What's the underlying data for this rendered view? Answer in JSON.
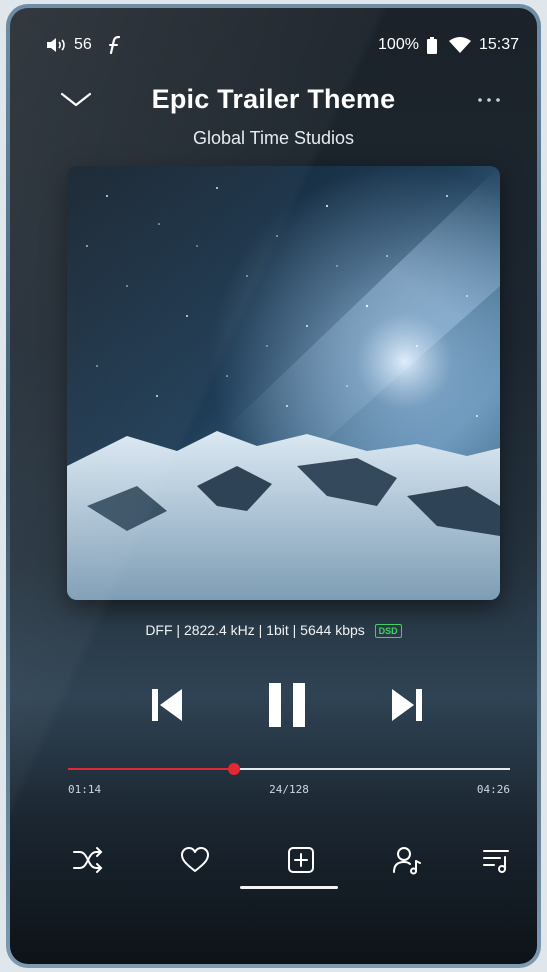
{
  "status_bar": {
    "volume": "56",
    "battery": "100%",
    "time": "15:37",
    "icons": [
      "volume-icon",
      "hi-res-icon",
      "battery-icon",
      "wifi-icon"
    ]
  },
  "header": {
    "title": "Epic Trailer Theme",
    "artist": "Global Time Studios"
  },
  "track_info": {
    "format": "DFF | 2822.4 kHz | 1bit | 5644 kbps",
    "badge": "DSD"
  },
  "playback": {
    "elapsed": "01:14",
    "duration": "04:26",
    "track_position": "24/128",
    "progress": 0.375,
    "state": "playing"
  },
  "controls": {
    "icons": [
      "previous-icon",
      "pause-icon",
      "next-icon"
    ]
  },
  "actions": {
    "icons": [
      "shuffle-icon",
      "heart-icon",
      "add-to-playlist-icon",
      "artist-icon",
      "queue-icon"
    ]
  },
  "colors": {
    "accent": "#e12833",
    "dsd_badge": "#44d061",
    "background_top": "#1b2229",
    "background_mid": "#2f4354"
  }
}
